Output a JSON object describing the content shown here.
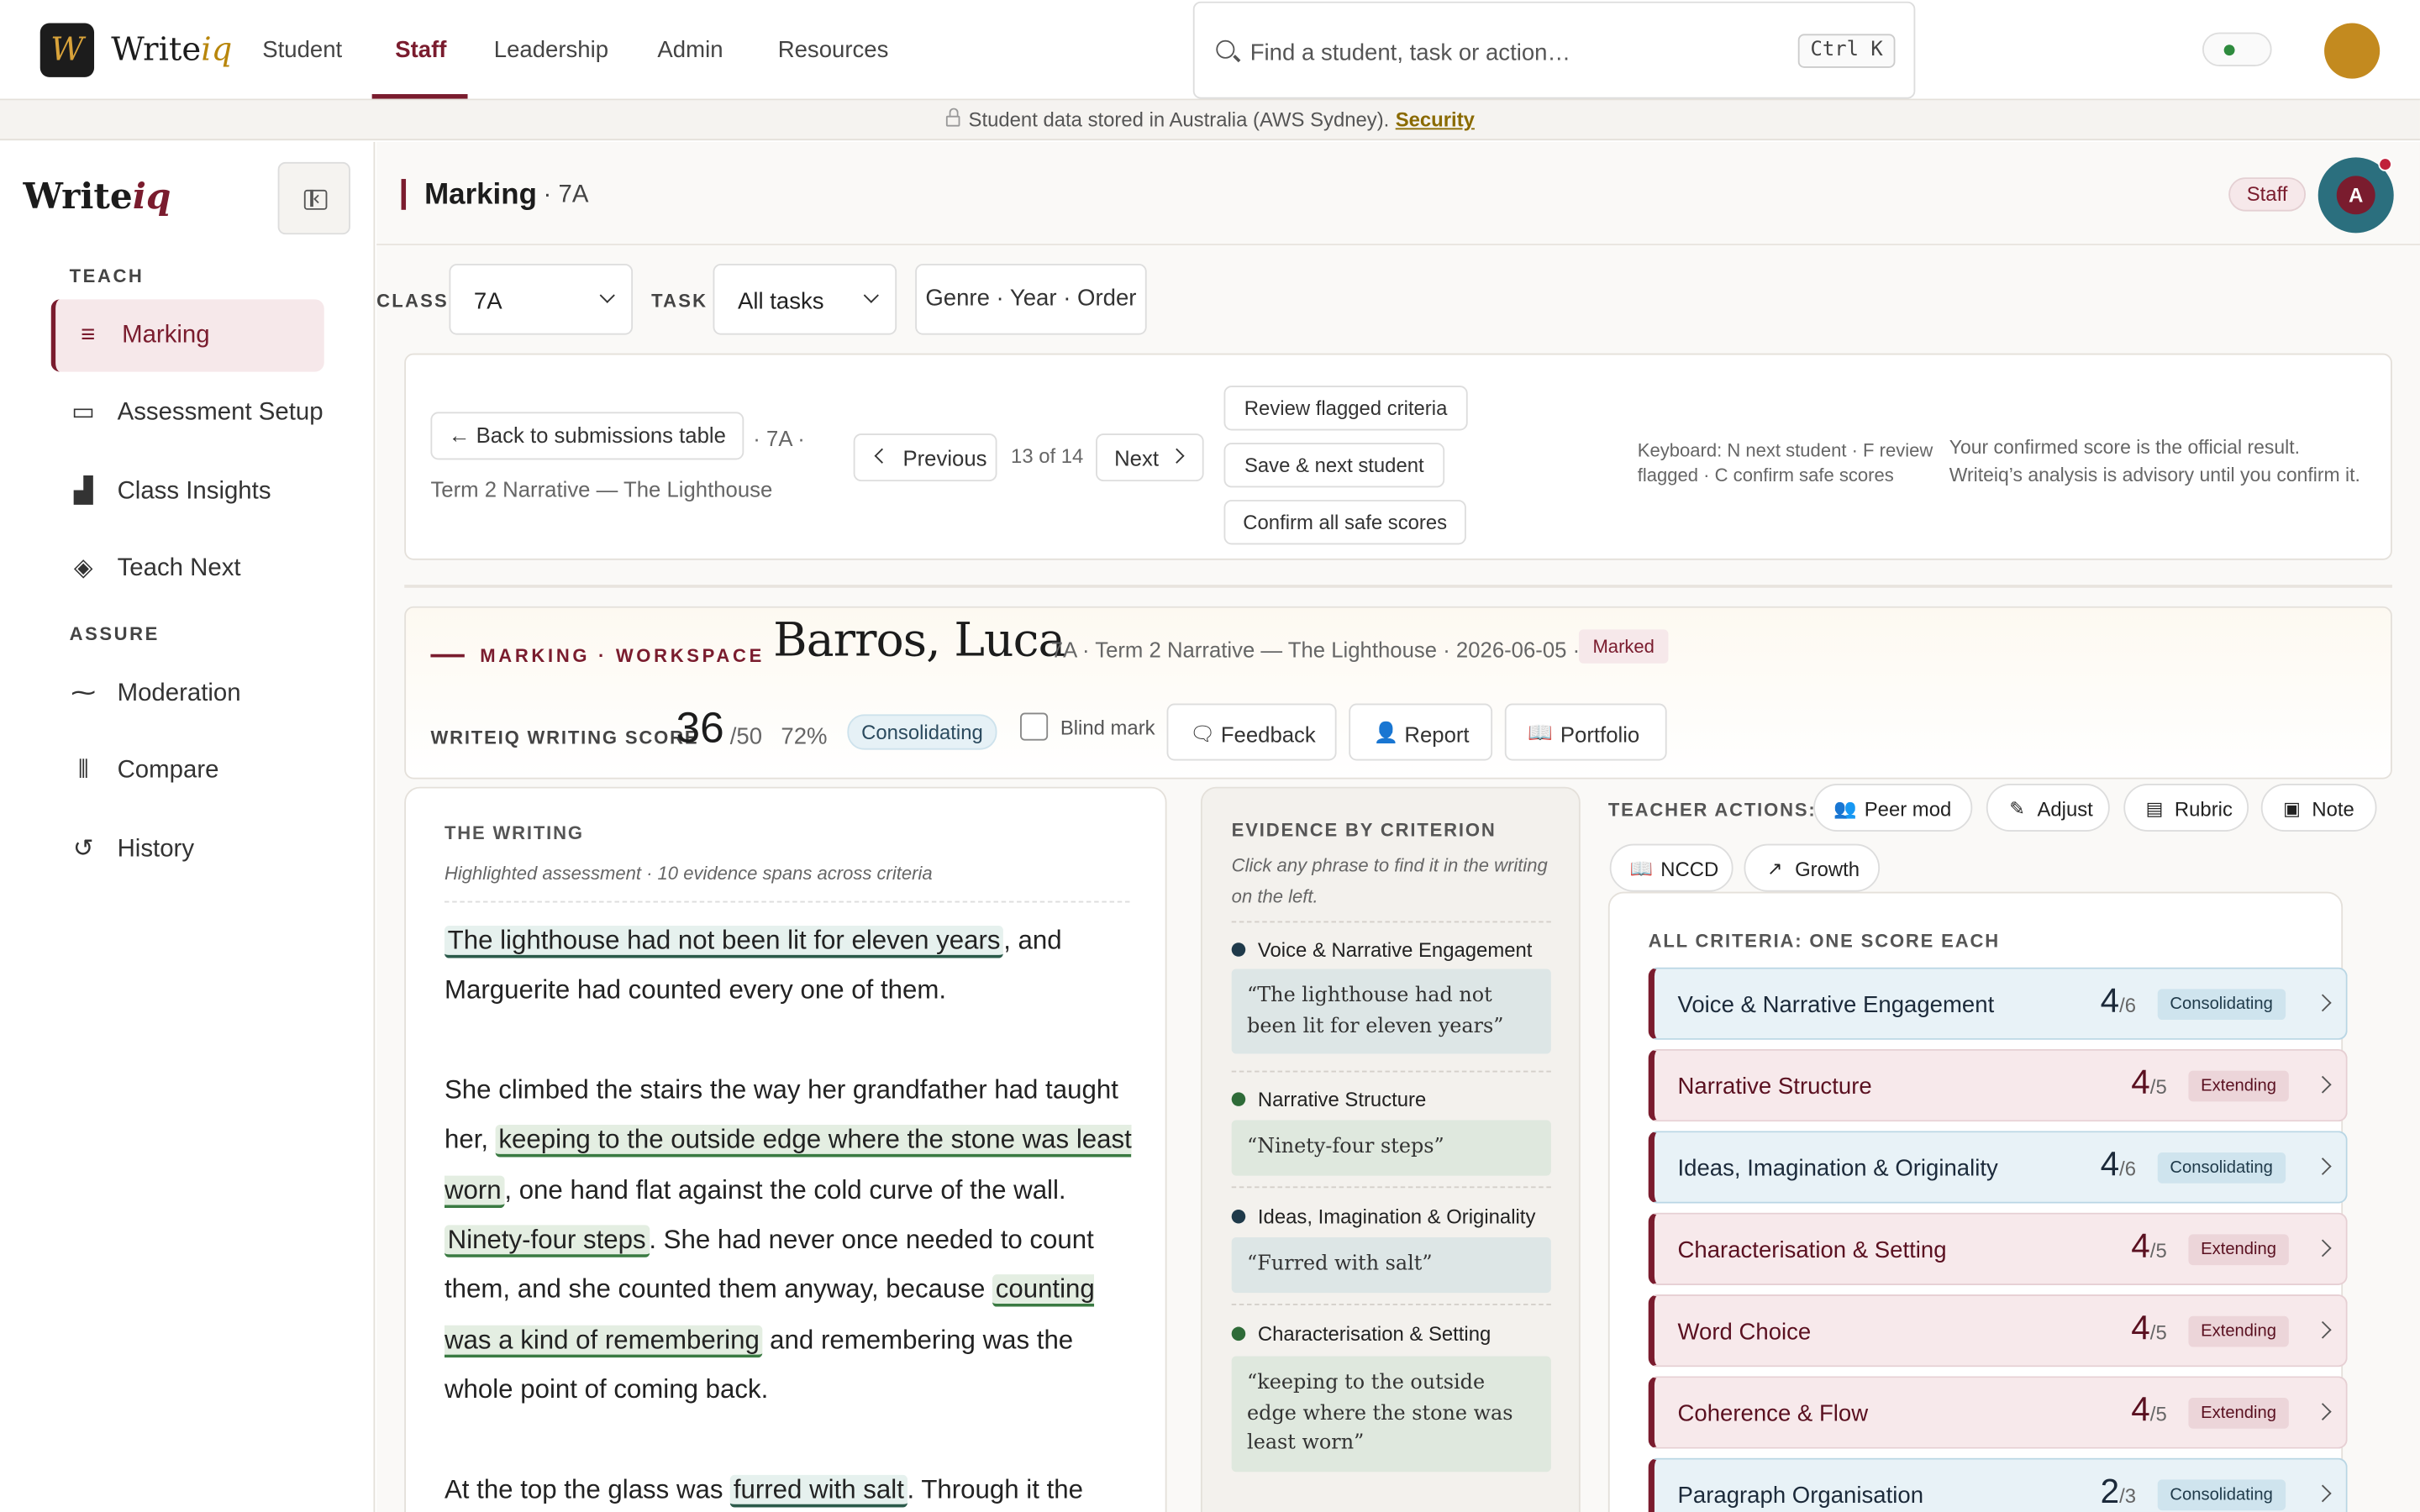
{
  "topnav": {
    "logo_letter": "W",
    "logo_write": "Write",
    "logo_iq": "iq",
    "tabs": [
      "Student",
      "Staff",
      "Leadership",
      "Admin",
      "Resources"
    ],
    "active_tab": "Staff",
    "search_placeholder": "Find a student, task or action…",
    "search_shortcut": "Ctrl K"
  },
  "banner": {
    "text": "Student data stored in Australia (AWS Sydney).",
    "link": "Security"
  },
  "sidebar": {
    "logo_write": "Write",
    "logo_iq": "iq",
    "sections": [
      {
        "label": "TEACH",
        "items": [
          {
            "label": "Marking",
            "icon": "menu-lines-icon",
            "active": true
          },
          {
            "label": "Assessment Setup",
            "icon": "card-icon"
          },
          {
            "label": "Class Insights",
            "icon": "bar-chart-icon"
          },
          {
            "label": "Teach Next",
            "icon": "layers-icon"
          }
        ]
      },
      {
        "label": "ASSURE",
        "items": [
          {
            "label": "Moderation",
            "icon": "balance-icon"
          },
          {
            "label": "Compare",
            "icon": "columns-icon"
          },
          {
            "label": "History",
            "icon": "history-icon"
          }
        ]
      }
    ]
  },
  "header": {
    "title": "Marking",
    "class_suffix": "· 7A",
    "role_badge": "Staff",
    "avatar_initial": "A"
  },
  "filters": {
    "class_label": "CLASS",
    "class_value": "7A",
    "task_label": "TASK",
    "task_value": "All tasks",
    "sort_button": "Genre · Year · Order"
  },
  "toolbar": {
    "back": "← Back to submissions table",
    "back_meta": "· 7A ·",
    "task_name": "Term 2 Narrative — The Lighthouse",
    "previous": "Previous",
    "position": "13 of 14",
    "next": "Next",
    "review_flagged": "Review flagged criteria",
    "save_next": "Save & next student",
    "confirm_safe": "Confirm all safe scores",
    "keyboard_line1": "Keyboard: N next student · F review",
    "keyboard_line2": "flagged · C confirm safe scores",
    "notice_line1": "Your confirmed score is the official result.",
    "notice_line2": "Writeiq’s analysis is advisory until you confirm it."
  },
  "workspace": {
    "kicker": "MARKING · WORKSPACE",
    "student": "Barros, Luca",
    "meta": "7A · Term 2 Narrative — The Lighthouse · 2026-06-05 ·",
    "status": "Marked",
    "score_label": "WRITEIQ WRITING SCORE",
    "score": "36",
    "score_of": "/50",
    "percent": "72%",
    "level": "Consolidating",
    "blind_mark": "Blind mark",
    "buttons": {
      "feedback": "Feedback",
      "report": "Report",
      "portfolio": "Portfolio"
    }
  },
  "writing": {
    "kicker": "THE WRITING",
    "subtitle": "Highlighted assessment · 10 evidence spans across criteria",
    "p1_hl1": "The lighthouse had not been lit for eleven years",
    "p1_t1": ", and Marguerite had counted every one of them.",
    "p2_t1": "She climbed the stairs the way her grandfather had taught her, ",
    "p2_hl1": "keeping to the outside edge where the stone was least worn",
    "p2_t2": ", one hand flat against the cold curve of the wall. ",
    "p2_hl2": "Ninety-four steps",
    "p2_t3": ". She had never once needed to count them, and she counted them anyway, because ",
    "p2_hl3": "counting was a kind of remembering",
    "p2_t4": " and remembering was the whole point of coming back.",
    "p3_t1": "At the top the glass was ",
    "p3_hl1": "furred with salt",
    "p3_t2": ". Through it the"
  },
  "evidence": {
    "kicker": "EVIDENCE BY CRITERION",
    "subtitle": "Click any phrase to find it in the writing on the left.",
    "items": [
      {
        "criterion": "Voice & Narrative Engagement",
        "quote": "“The lighthouse had not been lit for eleven years”"
      },
      {
        "criterion": "Narrative Structure",
        "quote": "“Ninety-four steps”"
      },
      {
        "criterion": "Ideas, Imagination & Originality",
        "quote": "“Furred with salt”"
      },
      {
        "criterion": "Characterisation & Setting",
        "quote": "“keeping to the outside edge where the stone was least worn”"
      }
    ]
  },
  "teacher_actions": {
    "label": "TEACHER ACTIONS:",
    "buttons": [
      "Peer mod",
      "Adjust",
      "Rubric",
      "Note",
      "NCCD",
      "Growth"
    ]
  },
  "criteria": {
    "kicker": "ALL CRITERIA: ONE SCORE EACH",
    "items": [
      {
        "name": "Voice & Narrative Engagement",
        "score": "4",
        "max": "/6",
        "level": "Consolidating"
      },
      {
        "name": "Narrative Structure",
        "score": "4",
        "max": "/5",
        "level": "Extending"
      },
      {
        "name": "Ideas, Imagination & Originality",
        "score": "4",
        "max": "/6",
        "level": "Consolidating"
      },
      {
        "name": "Characterisation & Setting",
        "score": "4",
        "max": "/5",
        "level": "Extending"
      },
      {
        "name": "Word Choice",
        "score": "4",
        "max": "/5",
        "level": "Extending"
      },
      {
        "name": "Coherence & Flow",
        "score": "4",
        "max": "/5",
        "level": "Extending"
      },
      {
        "name": "Paragraph Organisation",
        "score": "2",
        "max": "/3",
        "level": "Consolidating"
      }
    ]
  },
  "colors": {
    "accent": "#7a1c2e",
    "gold": "#c38a1f",
    "consolidating_bg": "#e8f2f7",
    "extending_bg": "#f7e9eb",
    "evidence_green": "#2e6b38"
  }
}
